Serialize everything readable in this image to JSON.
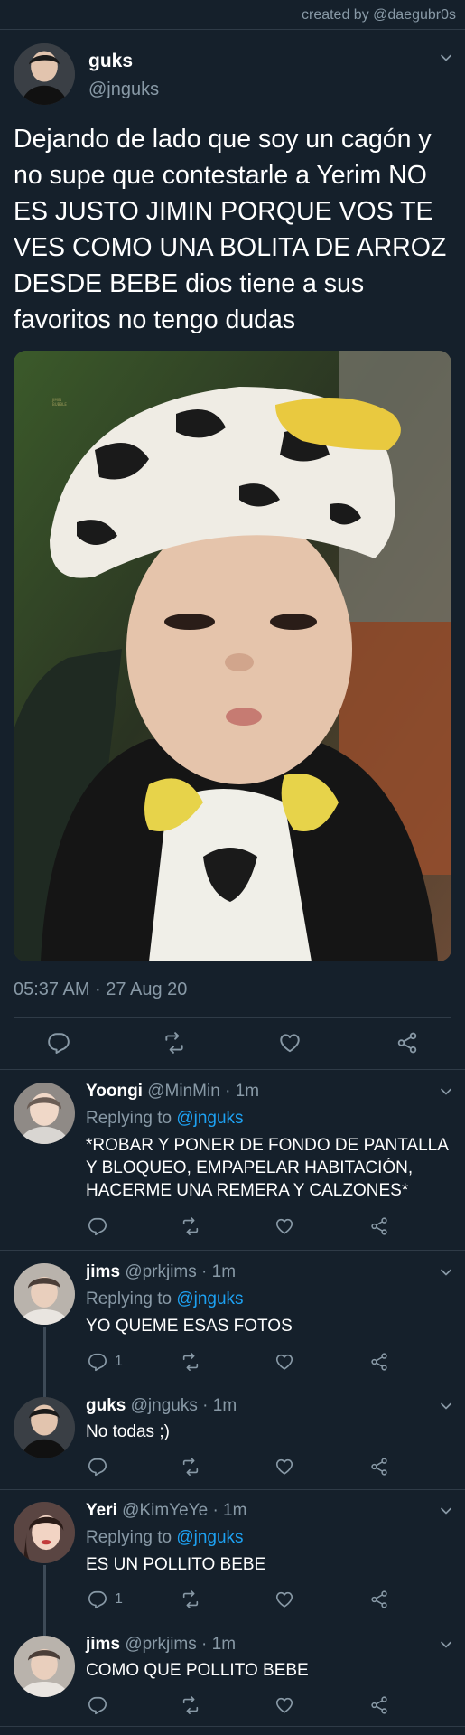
{
  "credit": "created by @daegubr0s",
  "main_tweet": {
    "name": "guks",
    "handle": "@jnguks",
    "text": "Dejando de lado que soy un cagón y no supe que contestarle a Yerim NO ES JUSTO JIMIN PORQUE VOS TE VES COMO UNA BOLITA DE ARROZ DESDE BEBE dios tiene a sus favoritos no tengo dudas",
    "timestamp": "05:37 AM · 27 Aug 20",
    "image_text": "JIMIN BUBBLE"
  },
  "replies": [
    {
      "name": "Yoongi",
      "handle": "@MinMin",
      "time": "· 1m",
      "replying_prefix": "Replying to ",
      "replying_to": "@jnguks",
      "text": "*ROBAR Y PONER DE FONDO DE PANTALLA Y BLOQUEO, EMPAPELAR HABITACIÓN, HACERME UNA REMERA Y CALZONES*",
      "reply_count": ""
    },
    {
      "name": "jims",
      "handle": "@prkjims",
      "time": "· 1m",
      "replying_prefix": "Replying to ",
      "replying_to": "@jnguks",
      "text": "YO QUEME ESAS FOTOS",
      "reply_count": "1"
    },
    {
      "name": "guks",
      "handle": "@jnguks",
      "time": "· 1m",
      "text": "No todas ;)",
      "reply_count": ""
    },
    {
      "name": "Yeri",
      "handle": "@KimYeYe",
      "time": "· 1m",
      "replying_prefix": "Replying to ",
      "replying_to": "@jnguks",
      "text": "ES UN POLLITO BEBE",
      "reply_count": "1"
    },
    {
      "name": "jims",
      "handle": "@prkjims",
      "time": "· 1m",
      "text": "COMO QUE POLLITO BEBE",
      "reply_count": ""
    }
  ],
  "icons": [
    "reply-icon",
    "retweet-icon",
    "like-icon",
    "share-icon",
    "chevron-down-icon"
  ],
  "colors": {
    "background": "#15202b",
    "muted": "#8899a6",
    "link": "#1da1f2",
    "divider": "#2f3b47"
  }
}
